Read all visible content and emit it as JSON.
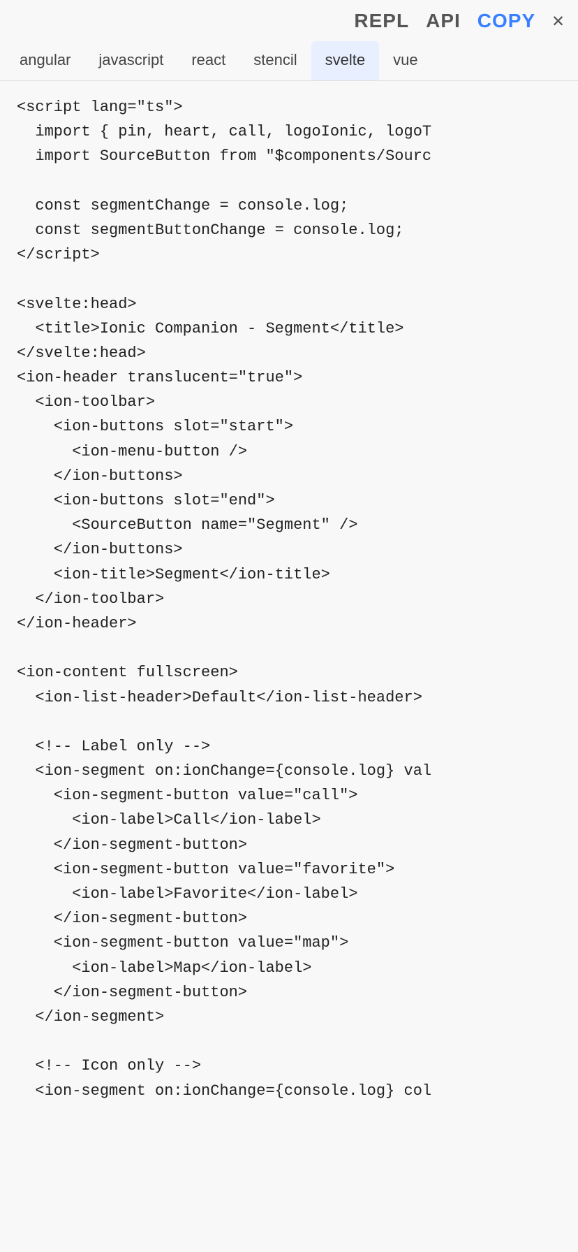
{
  "topNav": {
    "items": [
      {
        "label": "REPL",
        "active": false
      },
      {
        "label": "API",
        "active": false
      },
      {
        "label": "COPY",
        "active": true
      }
    ],
    "closeLabel": "✕"
  },
  "tabs": [
    {
      "label": "angular",
      "active": false
    },
    {
      "label": "javascript",
      "active": false
    },
    {
      "label": "react",
      "active": false
    },
    {
      "label": "stencil",
      "active": false
    },
    {
      "label": "svelte",
      "active": true
    },
    {
      "label": "vue",
      "active": false
    }
  ],
  "code": "<script lang=\"ts\">\n  import { pin, heart, call, logoIonic, logoT\n  import SourceButton from \"$components/Sourc\n\n  const segmentChange = console.log;\n  const segmentButtonChange = console.log;\n</script>\n\n<svelte:head>\n  <title>Ionic Companion - Segment</title>\n</svelte:head>\n<ion-header translucent=\"true\">\n  <ion-toolbar>\n    <ion-buttons slot=\"start\">\n      <ion-menu-button />\n    </ion-buttons>\n    <ion-buttons slot=\"end\">\n      <SourceButton name=\"Segment\" />\n    </ion-buttons>\n    <ion-title>Segment</ion-title>\n  </ion-toolbar>\n</ion-header>\n\n<ion-content fullscreen>\n  <ion-list-header>Default</ion-list-header>\n\n  <!-- Label only -->\n  <ion-segment on:ionChange={console.log} val\n    <ion-segment-button value=\"call\">\n      <ion-label>Call</ion-label>\n    </ion-segment-button>\n    <ion-segment-button value=\"favorite\">\n      <ion-label>Favorite</ion-label>\n    </ion-segment-button>\n    <ion-segment-button value=\"map\">\n      <ion-label>Map</ion-label>\n    </ion-segment-button>\n  </ion-segment>\n\n  <!-- Icon only -->\n  <ion-segment on:ionChange={console.log} col"
}
